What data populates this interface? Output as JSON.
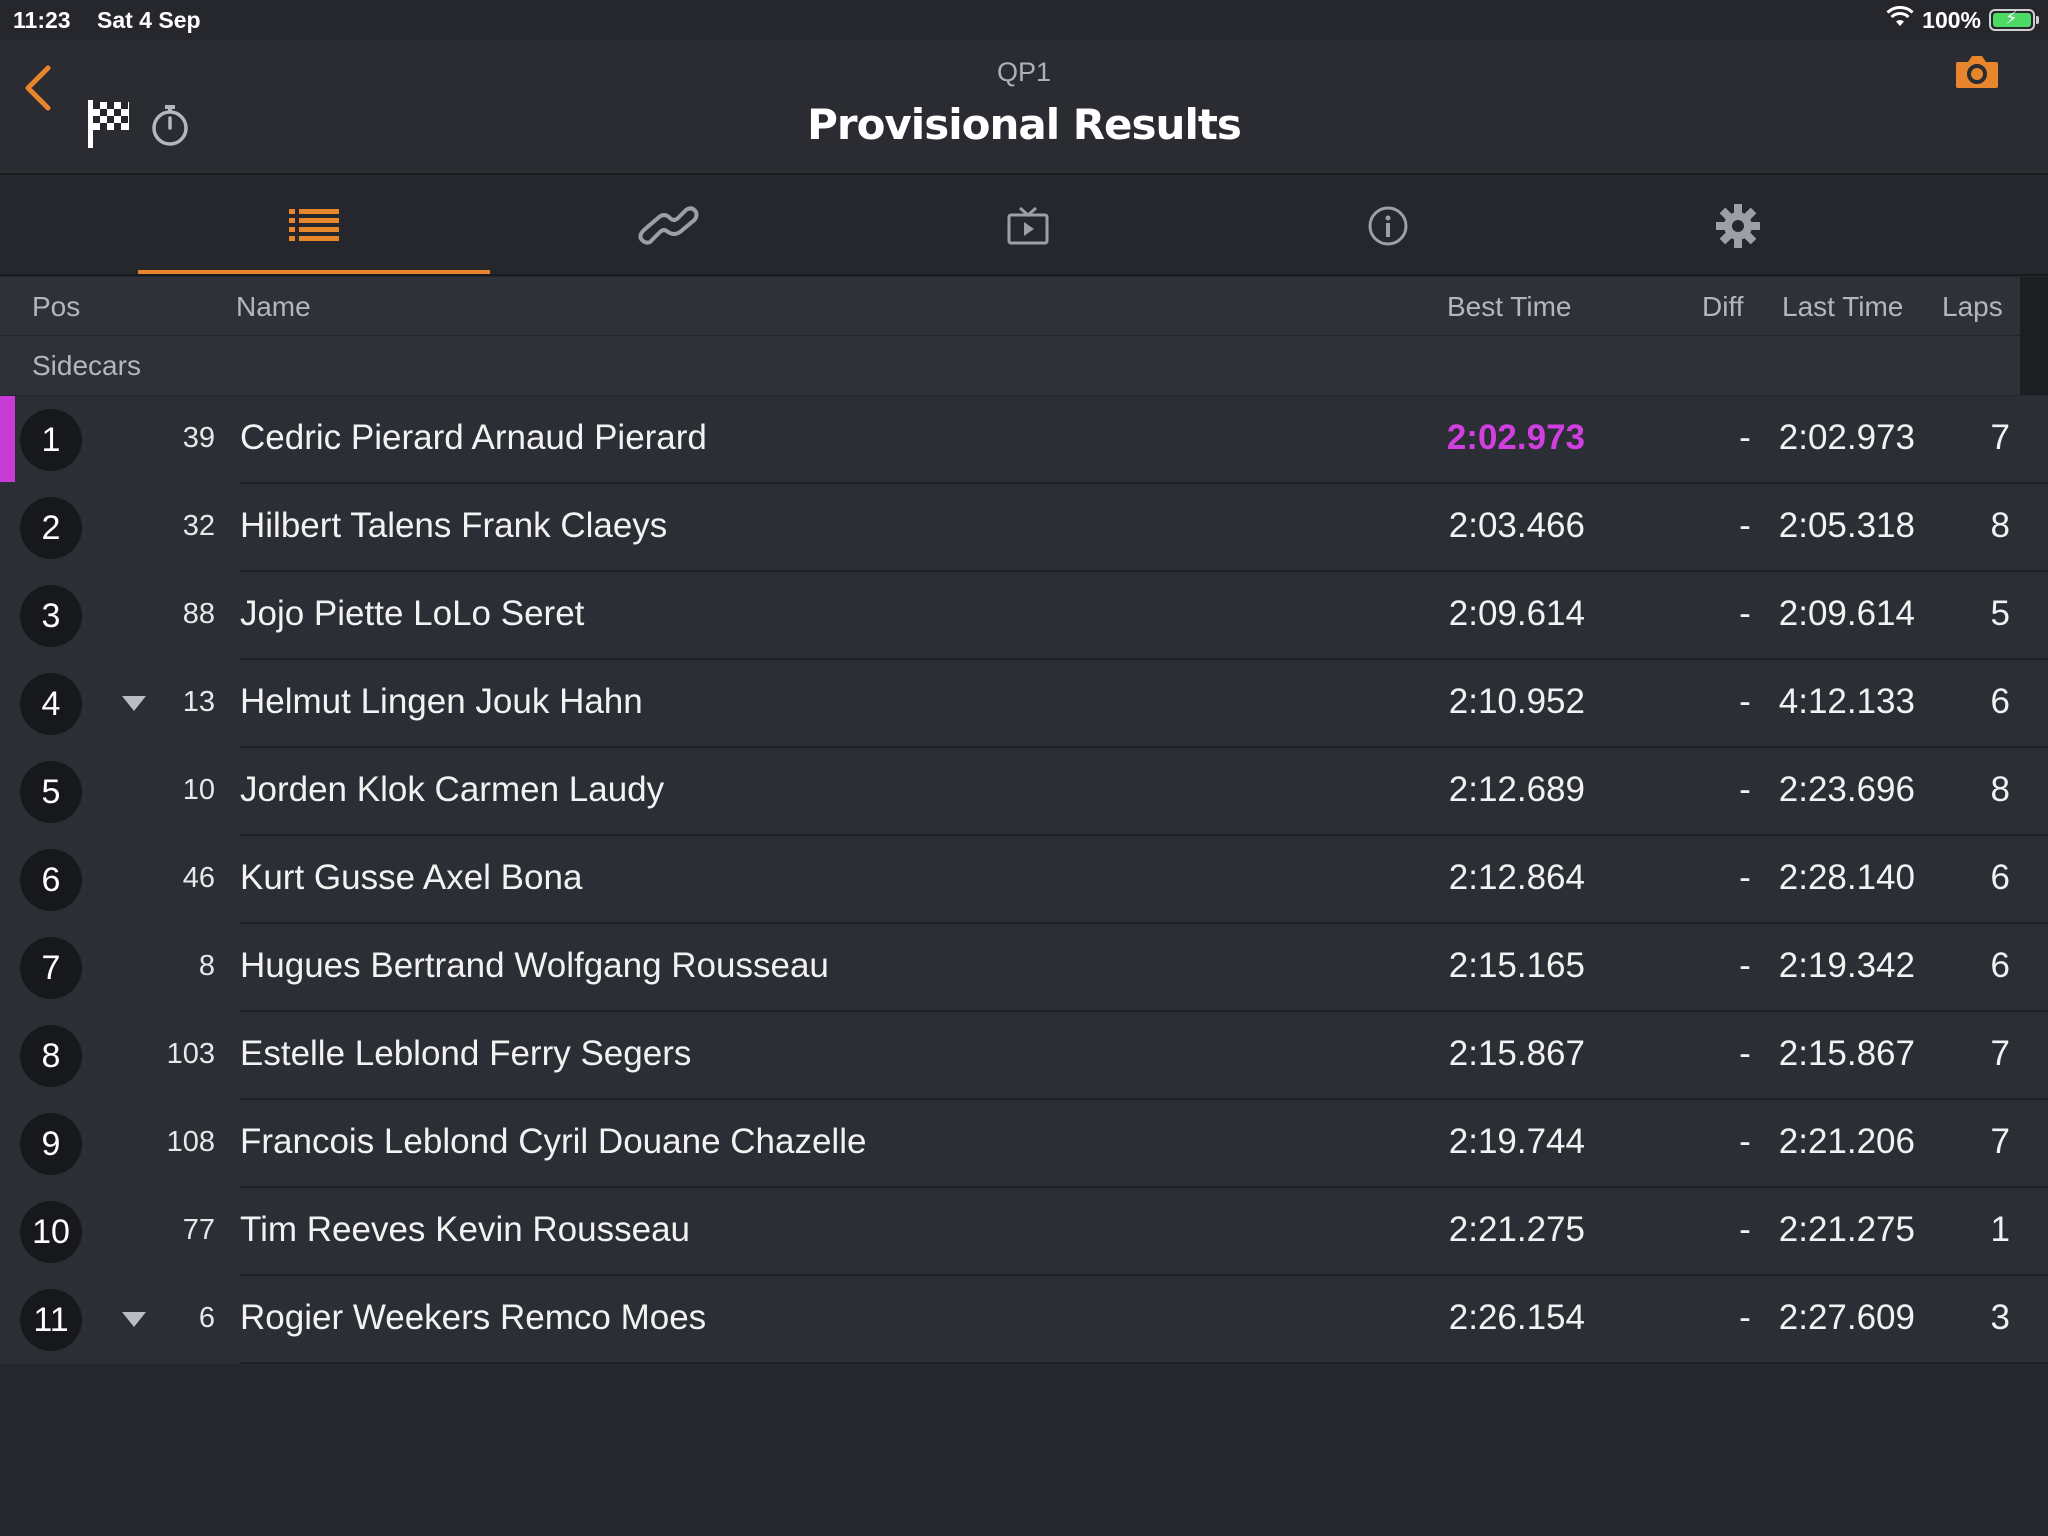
{
  "status_bar": {
    "time": "11:23",
    "date": "Sat 4 Sep",
    "battery": "100%"
  },
  "nav": {
    "subtitle": "QP1",
    "title": "Provisional Results"
  },
  "tabs": [
    {
      "icon": "list-icon",
      "active": true
    },
    {
      "icon": "track-icon",
      "active": false
    },
    {
      "icon": "tv-icon",
      "active": false
    },
    {
      "icon": "info-icon",
      "active": false
    },
    {
      "icon": "gear-icon",
      "active": false
    }
  ],
  "columns": {
    "pos": "Pos",
    "name": "Name",
    "best_time": "Best Time",
    "diff": "Diff",
    "last_time": "Last Time",
    "laps": "Laps"
  },
  "group": "Sidecars",
  "colors": {
    "accent": "#e8862d",
    "fastest": "#d23fe0"
  },
  "results": [
    {
      "pos": "1",
      "num": "39",
      "name": "Cedric Pierard Arnaud Pierard",
      "best": "2:02.973",
      "diff": "-",
      "last": "2:02.973",
      "laps": "7",
      "fastest": true,
      "trend": ""
    },
    {
      "pos": "2",
      "num": "32",
      "name": "Hilbert Talens Frank Claeys",
      "best": "2:03.466",
      "diff": "-",
      "last": "2:05.318",
      "laps": "8",
      "fastest": false,
      "trend": ""
    },
    {
      "pos": "3",
      "num": "88",
      "name": "Jojo Piette LoLo Seret",
      "best": "2:09.614",
      "diff": "-",
      "last": "2:09.614",
      "laps": "5",
      "fastest": false,
      "trend": ""
    },
    {
      "pos": "4",
      "num": "13",
      "name": "Helmut Lingen Jouk Hahn",
      "best": "2:10.952",
      "diff": "-",
      "last": "4:12.133",
      "laps": "6",
      "fastest": false,
      "trend": "down"
    },
    {
      "pos": "5",
      "num": "10",
      "name": "Jorden Klok Carmen Laudy",
      "best": "2:12.689",
      "diff": "-",
      "last": "2:23.696",
      "laps": "8",
      "fastest": false,
      "trend": ""
    },
    {
      "pos": "6",
      "num": "46",
      "name": "Kurt Gusse Axel Bona",
      "best": "2:12.864",
      "diff": "-",
      "last": "2:28.140",
      "laps": "6",
      "fastest": false,
      "trend": ""
    },
    {
      "pos": "7",
      "num": "8",
      "name": "Hugues Bertrand Wolfgang Rousseau",
      "best": "2:15.165",
      "diff": "-",
      "last": "2:19.342",
      "laps": "6",
      "fastest": false,
      "trend": ""
    },
    {
      "pos": "8",
      "num": "103",
      "name": "Estelle Leblond Ferry Segers",
      "best": "2:15.867",
      "diff": "-",
      "last": "2:15.867",
      "laps": "7",
      "fastest": false,
      "trend": ""
    },
    {
      "pos": "9",
      "num": "108",
      "name": "Francois Leblond Cyril Douane Chazelle",
      "best": "2:19.744",
      "diff": "-",
      "last": "2:21.206",
      "laps": "7",
      "fastest": false,
      "trend": ""
    },
    {
      "pos": "10",
      "num": "77",
      "name": "Tim Reeves Kevin Rousseau",
      "best": "2:21.275",
      "diff": "-",
      "last": "2:21.275",
      "laps": "1",
      "fastest": false,
      "trend": ""
    },
    {
      "pos": "11",
      "num": "6",
      "name": "Rogier Weekers Remco Moes",
      "best": "2:26.154",
      "diff": "-",
      "last": "2:27.609",
      "laps": "3",
      "fastest": false,
      "trend": "down"
    }
  ]
}
